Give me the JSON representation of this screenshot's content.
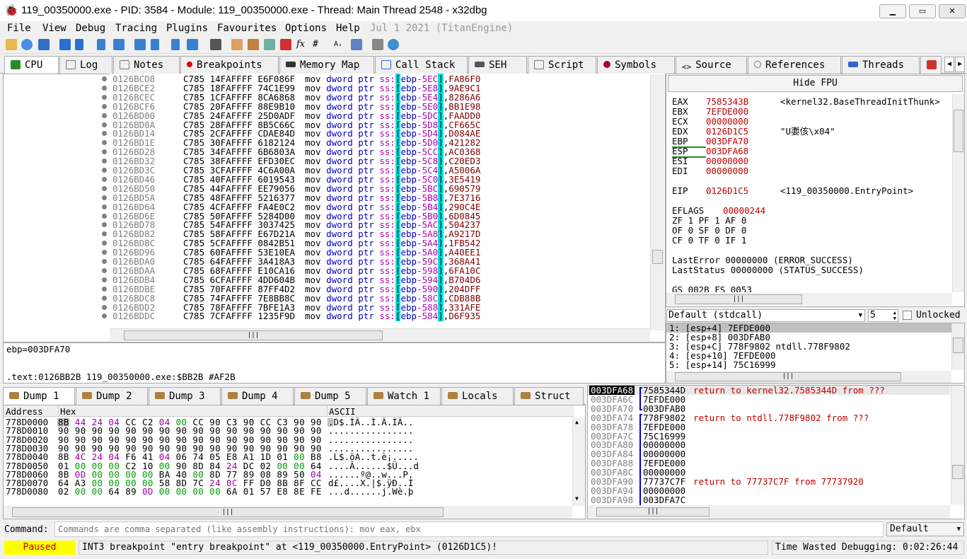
{
  "title": "119_00350000.exe - PID: 3584 - Module: 119_00350000.exe - Thread: Main Thread 2548 - x32dbg",
  "menu": [
    "File",
    "View",
    "Debug",
    "Tracing",
    "Plugins",
    "Favourites",
    "Options",
    "Help"
  ],
  "menu_date": "Jul 1 2021 (TitanEngine)",
  "tabs": [
    {
      "label": "CPU",
      "icon": "cpu-icon",
      "color": "#2a8a2a"
    },
    {
      "label": "Log",
      "icon": "log-icon",
      "color": "#777"
    },
    {
      "label": "Notes",
      "icon": "notes-icon",
      "color": "#777"
    },
    {
      "label": "Breakpoints",
      "icon": "breakpoint-icon",
      "color": "#d00"
    },
    {
      "label": "Memory Map",
      "icon": "memory-map-icon",
      "color": "#333"
    },
    {
      "label": "Call Stack",
      "icon": "call-stack-icon",
      "color": "#36c"
    },
    {
      "label": "SEH",
      "icon": "seh-icon",
      "color": "#555"
    },
    {
      "label": "Script",
      "icon": "script-icon",
      "color": "#777"
    },
    {
      "label": "Symbols",
      "icon": "symbols-icon",
      "color": "#a03"
    },
    {
      "label": "Source",
      "icon": "source-icon",
      "color": "#555"
    },
    {
      "label": "References",
      "icon": "references-icon",
      "color": "#777"
    },
    {
      "label": "Threads",
      "icon": "threads-icon",
      "color": "#36c"
    }
  ],
  "disasm": [
    {
      "a": "0126BCD8",
      "b": "C785 14FAFFFF E6F086F",
      "o": "-5EC",
      "v": "FA86F0"
    },
    {
      "a": "0126BCE2",
      "b": "C785 18FAFFFF 74C1E99",
      "o": "-5E8",
      "v": "9AE9C1"
    },
    {
      "a": "0126BCEC",
      "b": "C785 1CFAFFFF 8CA6868",
      "o": "-5E4",
      "v": "8286A6"
    },
    {
      "a": "0126BCF6",
      "b": "C785 20FAFFFF 88E9B10",
      "o": "-5E0",
      "v": "BB1E98"
    },
    {
      "a": "0126BD00",
      "b": "C785 24FAFFFF 25D0ADF",
      "o": "-5DC",
      "v": "FAADD0"
    },
    {
      "a": "0126BD0A",
      "b": "C785 28FAFFFF 8B5C66C",
      "o": "-5D8",
      "v": "CF665C"
    },
    {
      "a": "0126BD14",
      "b": "C785 2CFAFFFF CDAE84D",
      "o": "-5D4",
      "v": "D084AE"
    },
    {
      "a": "0126BD1E",
      "b": "C785 30FAFFFF 6182124",
      "o": "-5D0",
      "v": "421282"
    },
    {
      "a": "0126BD28",
      "b": "C785 34FAFFFF 6B6803A",
      "o": "-5CC",
      "v": "AC0368"
    },
    {
      "a": "0126BD32",
      "b": "C785 38FAFFFF EFD30EC",
      "o": "-5C8",
      "v": "C20ED3"
    },
    {
      "a": "0126BD3C",
      "b": "C785 3CFAFFFF 4C6A00A",
      "o": "-5C4",
      "v": "A5006A"
    },
    {
      "a": "0126BD46",
      "b": "C785 40FAFFFF 6019543",
      "o": "-5C0",
      "v": "3E5419"
    },
    {
      "a": "0126BD50",
      "b": "C785 44FAFFFF EE79056",
      "o": "-5BC",
      "v": "690579"
    },
    {
      "a": "0126BD5A",
      "b": "C785 48FAFFFF 5216377",
      "o": "-5B8",
      "v": "7E3716"
    },
    {
      "a": "0126BD64",
      "b": "C785 4CFAFFFF FA4E0C2",
      "o": "-5B4",
      "v": "290C4E"
    },
    {
      "a": "0126BD6E",
      "b": "C785 50FAFFFF 5284D00",
      "o": "-5B0",
      "v": "6D0845"
    },
    {
      "a": "0126BD78",
      "b": "C785 54FAFFFF 3037425",
      "o": "-5AC",
      "v": "504237"
    },
    {
      "a": "0126BD82",
      "b": "C785 58FAFFFF E67D21A",
      "o": "-5A8",
      "v": "A9217D"
    },
    {
      "a": "0126BD8C",
      "b": "C785 5CFAFFFF 0842B51",
      "o": "-5A4",
      "v": "1FB542"
    },
    {
      "a": "0126BD96",
      "b": "C785 60FAFFFF 53E10EA",
      "o": "-5A0",
      "v": "A40EE1"
    },
    {
      "a": "0126BDA0",
      "b": "C785 64FAFFFF 3A418A3",
      "o": "-59C",
      "v": "368A41"
    },
    {
      "a": "0126BDAA",
      "b": "C785 68FAFFFF E10CA16",
      "o": "-598",
      "v": "6FA10C"
    },
    {
      "a": "0126BDB4",
      "b": "C785 6CFAFFFF 4DD604B",
      "o": "-594",
      "v": "B704D6"
    },
    {
      "a": "0126BDBE",
      "b": "C785 70FAFFFF 87FF4D2",
      "o": "-590",
      "v": "204DFF"
    },
    {
      "a": "0126BDC8",
      "b": "C785 74FAFFFF 7E8BB8C",
      "o": "-58C",
      "v": "CDB88B"
    },
    {
      "a": "0126BDD2",
      "b": "C785 78FAFFFF 7BFE1A3",
      "o": "-588",
      "v": "331AFE"
    },
    {
      "a": "0126BDDC",
      "b": "C785 7CFAFFFF 1235F9D",
      "o": "-584",
      "v": "D6F935"
    }
  ],
  "disasm_parts": {
    "mnemonic": "mov",
    "size": "dword ptr",
    "segment": "ss:",
    "base": "ebp"
  },
  "info": {
    "line1": "ebp=003DFA70",
    "line2": ".text:0126BB2B 119_00350000.exe:$BB2B #AF2B"
  },
  "fpu_button": "Hide FPU",
  "registers": [
    {
      "n": "EAX",
      "v": "7585343B",
      "c": "<kernel32.BaseThreadInitThunk>"
    },
    {
      "n": "EBX",
      "v": "7EFDE000",
      "c": ""
    },
    {
      "n": "ECX",
      "v": "00000000",
      "c": ""
    },
    {
      "n": "EDX",
      "v": "0126D1C5",
      "c": "\"U嬱侅\\x04\""
    },
    {
      "n": "EBP",
      "v": "003DFA70",
      "c": ""
    },
    {
      "n": "ESP",
      "v": "003DFA68",
      "c": ""
    },
    {
      "n": "ESI",
      "v": "00000000",
      "c": ""
    },
    {
      "n": "EDI",
      "v": "00000000",
      "c": ""
    }
  ],
  "eip": {
    "n": "EIP",
    "v": "0126D1C5",
    "c": "<119_00350000.EntryPoint>"
  },
  "eflags": {
    "n": "EFLAGS",
    "v": "00000244"
  },
  "flags": [
    "ZF 1  PF 1  AF 0",
    "OF 0  SF 0  DF 0",
    "CF 0  TF 0  IF 1"
  ],
  "last": [
    "LastError  00000000 (ERROR_SUCCESS)",
    "LastStatus 00000000 (STATUS_SUCCESS)"
  ],
  "segs": "GS 002B  FS 0053",
  "callconv": {
    "value": "Default (stdcall)",
    "count": "5",
    "unlocked": "Unlocked"
  },
  "args": [
    "1: [esp+4] 7EFDE000",
    "2: [esp+8] 003DFAB0",
    "3: [esp+C] 778F9802 ntdll.778F9802",
    "4: [esp+10] 7EFDE000",
    "5: [esp+14] 75C16999"
  ],
  "dump_tabs": [
    {
      "label": "Dump 1",
      "icon": "dump-icon"
    },
    {
      "label": "Dump 2",
      "icon": "dump-icon"
    },
    {
      "label": "Dump 3",
      "icon": "dump-icon"
    },
    {
      "label": "Dump 4",
      "icon": "dump-icon"
    },
    {
      "label": "Dump 5",
      "icon": "dump-icon"
    },
    {
      "label": "Watch 1",
      "icon": "watch-icon"
    },
    {
      "label": "Locals",
      "icon": "locals-icon"
    },
    {
      "label": "Struct",
      "icon": "struct-icon"
    }
  ],
  "dump_headers": {
    "address": "Address",
    "hex": "Hex",
    "ascii": "ASCII"
  },
  "dump": [
    {
      "a": "778D0000",
      "h": "8B 44 24 04 CC C2 04 00 CC 90 C3 90 CC C3 90 90",
      "s": ".D$.ÌÂ..Ì.Ã.ÌÃ.."
    },
    {
      "a": "778D0010",
      "h": "90 90 90 90 90 90 90 90 90 90 90 90 90 90 90 90",
      "s": "................"
    },
    {
      "a": "778D0020",
      "h": "90 90 90 90 90 90 90 90 90 90 90 90 90 90 90 90",
      "s": "................"
    },
    {
      "a": "778D0030",
      "h": "90 90 90 90 90 90 90 90 90 90 90 90 90 90 90 90",
      "s": "................"
    },
    {
      "a": "778D0040",
      "h": "8B 4C 24 04 F6 41 04 06 74 05 E8 A1 1D 01 00 B8",
      "s": ".L$.öA..t.è¡....."
    },
    {
      "a": "778D0050",
      "h": "01 00 00 00 C2 10 00 90 8D 84 24 DC 02 00 00 64",
      "s": "....Â......$Ü...d"
    },
    {
      "a": "778D0060",
      "h": "8B 0D 00 00 00 00 BA 40 00 8D 77 89 08 89 50 04",
      "s": "......º@..w...P."
    },
    {
      "a": "778D0070",
      "h": "64 A3 00 00 00 00 58 8D 7C 24 0C FF D0 8B 8F CC",
      "s": "d£....X.|$.ÿÐ..Ì"
    },
    {
      "a": "778D0080",
      "h": "02 00 00 64 89 0D 00 00 00 00 6A 01 57 E8 8E FE",
      "s": "...d......j.Wè.þ"
    }
  ],
  "stack": [
    {
      "a": "003DFA68",
      "v": "7585344D",
      "c": "return to kernel32.7585344D from ???",
      "sel": true
    },
    {
      "a": "003DFA6C",
      "v": "7EFDE000",
      "c": ""
    },
    {
      "a": "003DFA70",
      "v": "003DFAB0",
      "c": ""
    },
    {
      "a": "003DFA74",
      "v": "778F9802",
      "c": "return to ntdll.778F9802 from ???"
    },
    {
      "a": "003DFA78",
      "v": "7EFDE000",
      "c": ""
    },
    {
      "a": "003DFA7C",
      "v": "75C16999",
      "c": ""
    },
    {
      "a": "003DFA80",
      "v": "00000000",
      "c": ""
    },
    {
      "a": "003DFA84",
      "v": "00000000",
      "c": ""
    },
    {
      "a": "003DFA88",
      "v": "7EFDE000",
      "c": ""
    },
    {
      "a": "003DFA8C",
      "v": "00000000",
      "c": ""
    },
    {
      "a": "003DFA90",
      "v": "77737C7F",
      "c": "return to 77737C7F from 77737920"
    },
    {
      "a": "003DFA94",
      "v": "00000000",
      "c": ""
    },
    {
      "a": "003DFA98",
      "v": "003DFA7C",
      "c": ""
    }
  ],
  "command": {
    "label": "Command:",
    "placeholder": "Commands are comma separated (like assembly instructions): mov eax, ebx",
    "mode": "Default"
  },
  "status": {
    "state": "Paused",
    "message": "INT3 breakpoint \"entry breakpoint\" at <119_00350000.EntryPoint> (0126D1C5)!",
    "time": "Time Wasted Debugging: 0:02:26:44"
  }
}
